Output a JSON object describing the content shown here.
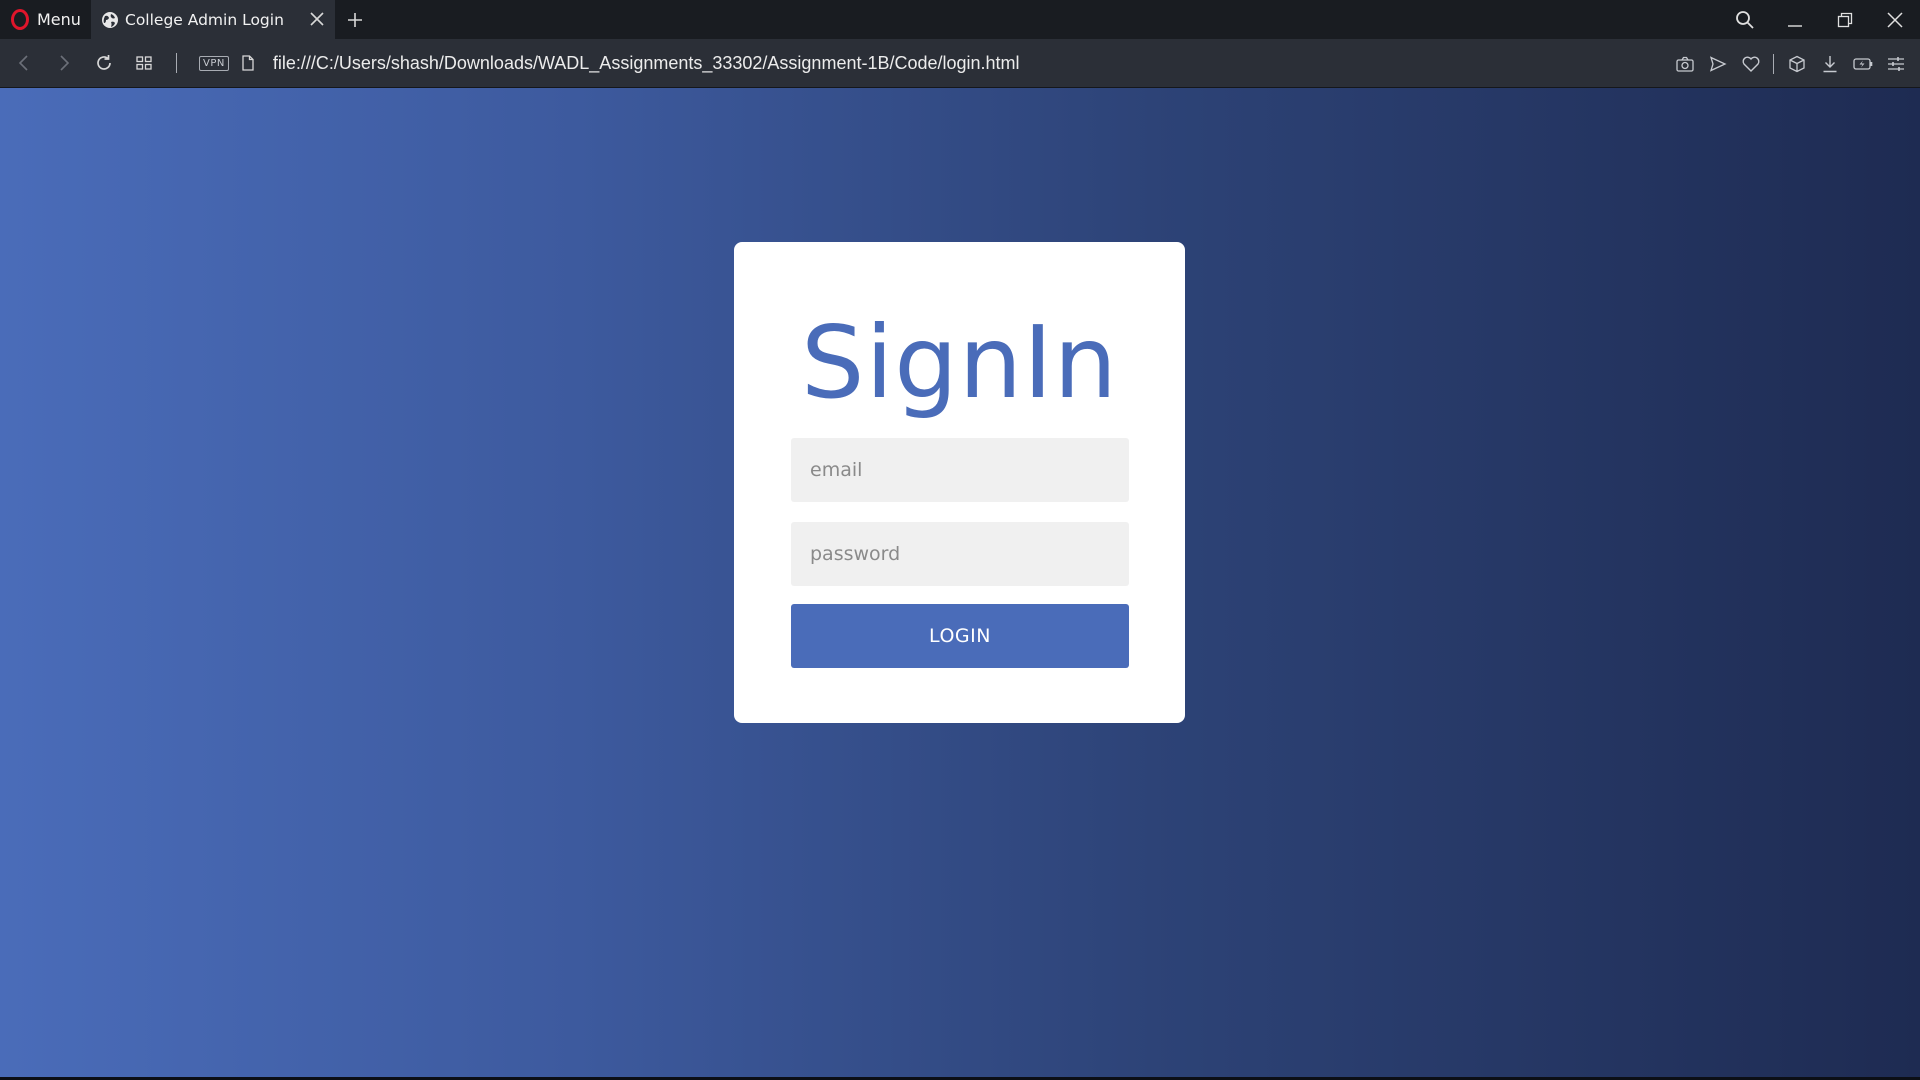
{
  "browser": {
    "menu_label": "Menu",
    "tab_title": "College Admin Login",
    "url": "file:///C:/Users/shash/Downloads/WADL_Assignments_33302/Assignment-1B/Code/login.html",
    "vpn_label": "VPN"
  },
  "login": {
    "title": "SignIn",
    "email_placeholder": "email",
    "password_placeholder": "password",
    "button_label": "LOGIN"
  },
  "colors": {
    "accent": "#4a6cb9",
    "gradient_start": "#4a6cb9",
    "gradient_end": "#1e2b52",
    "opera_red": "#e0152b"
  },
  "icons": {
    "tabbar": [
      "opera-logo-icon",
      "globe-icon",
      "close-icon",
      "plus-icon"
    ],
    "window": [
      "search-icon",
      "minimize-icon",
      "restore-icon",
      "close-window-icon"
    ],
    "toolbar_left": [
      "back-arrow-icon",
      "forward-arrow-icon",
      "reload-icon",
      "speed-dial-icon",
      "file-icon"
    ],
    "toolbar_right": [
      "camera-icon",
      "send-icon",
      "heart-icon",
      "cube-icon",
      "download-icon",
      "battery-icon",
      "settings-sliders-icon"
    ]
  }
}
